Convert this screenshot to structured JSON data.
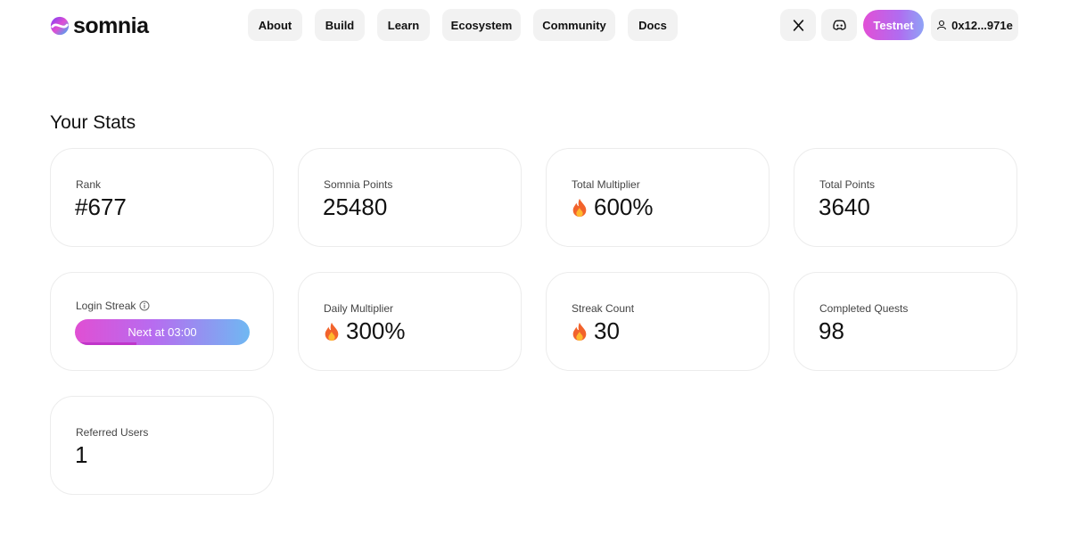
{
  "brand": {
    "name": "somnia"
  },
  "nav": {
    "items": [
      {
        "label": "About"
      },
      {
        "label": "Build"
      },
      {
        "label": "Learn"
      },
      {
        "label": "Ecosystem"
      },
      {
        "label": "Community"
      },
      {
        "label": "Docs"
      }
    ]
  },
  "header_actions": {
    "x_icon": "x-icon",
    "discord_icon": "discord-icon",
    "network_label": "Testnet",
    "wallet_address": "0x12...971e",
    "wallet_icon": "user-icon"
  },
  "stats": {
    "title": "Your Stats",
    "rank": {
      "label": "Rank",
      "value": "#677"
    },
    "somnia_points": {
      "label": "Somnia Points",
      "value": "25480"
    },
    "total_multiplier": {
      "label": "Total Multiplier",
      "value": "600%",
      "icon": "fire-icon"
    },
    "total_points": {
      "label": "Total Points",
      "value": "3640"
    },
    "login_streak": {
      "label": "Login Streak",
      "button_label": "Next at 03:00",
      "progress": 0.35
    },
    "daily_multiplier": {
      "label": "Daily Multiplier",
      "value": "300%",
      "icon": "fire-icon"
    },
    "streak_count": {
      "label": "Streak Count",
      "value": "30",
      "icon": "fire-icon"
    },
    "completed_quests": {
      "label": "Completed Quests",
      "value": "98"
    },
    "referred_users": {
      "label": "Referred Users",
      "value": "1"
    }
  },
  "colors": {
    "accent_pink": "#e24fd6",
    "accent_blue": "#6fb8f2",
    "button_bg": "#f2f2f2"
  }
}
